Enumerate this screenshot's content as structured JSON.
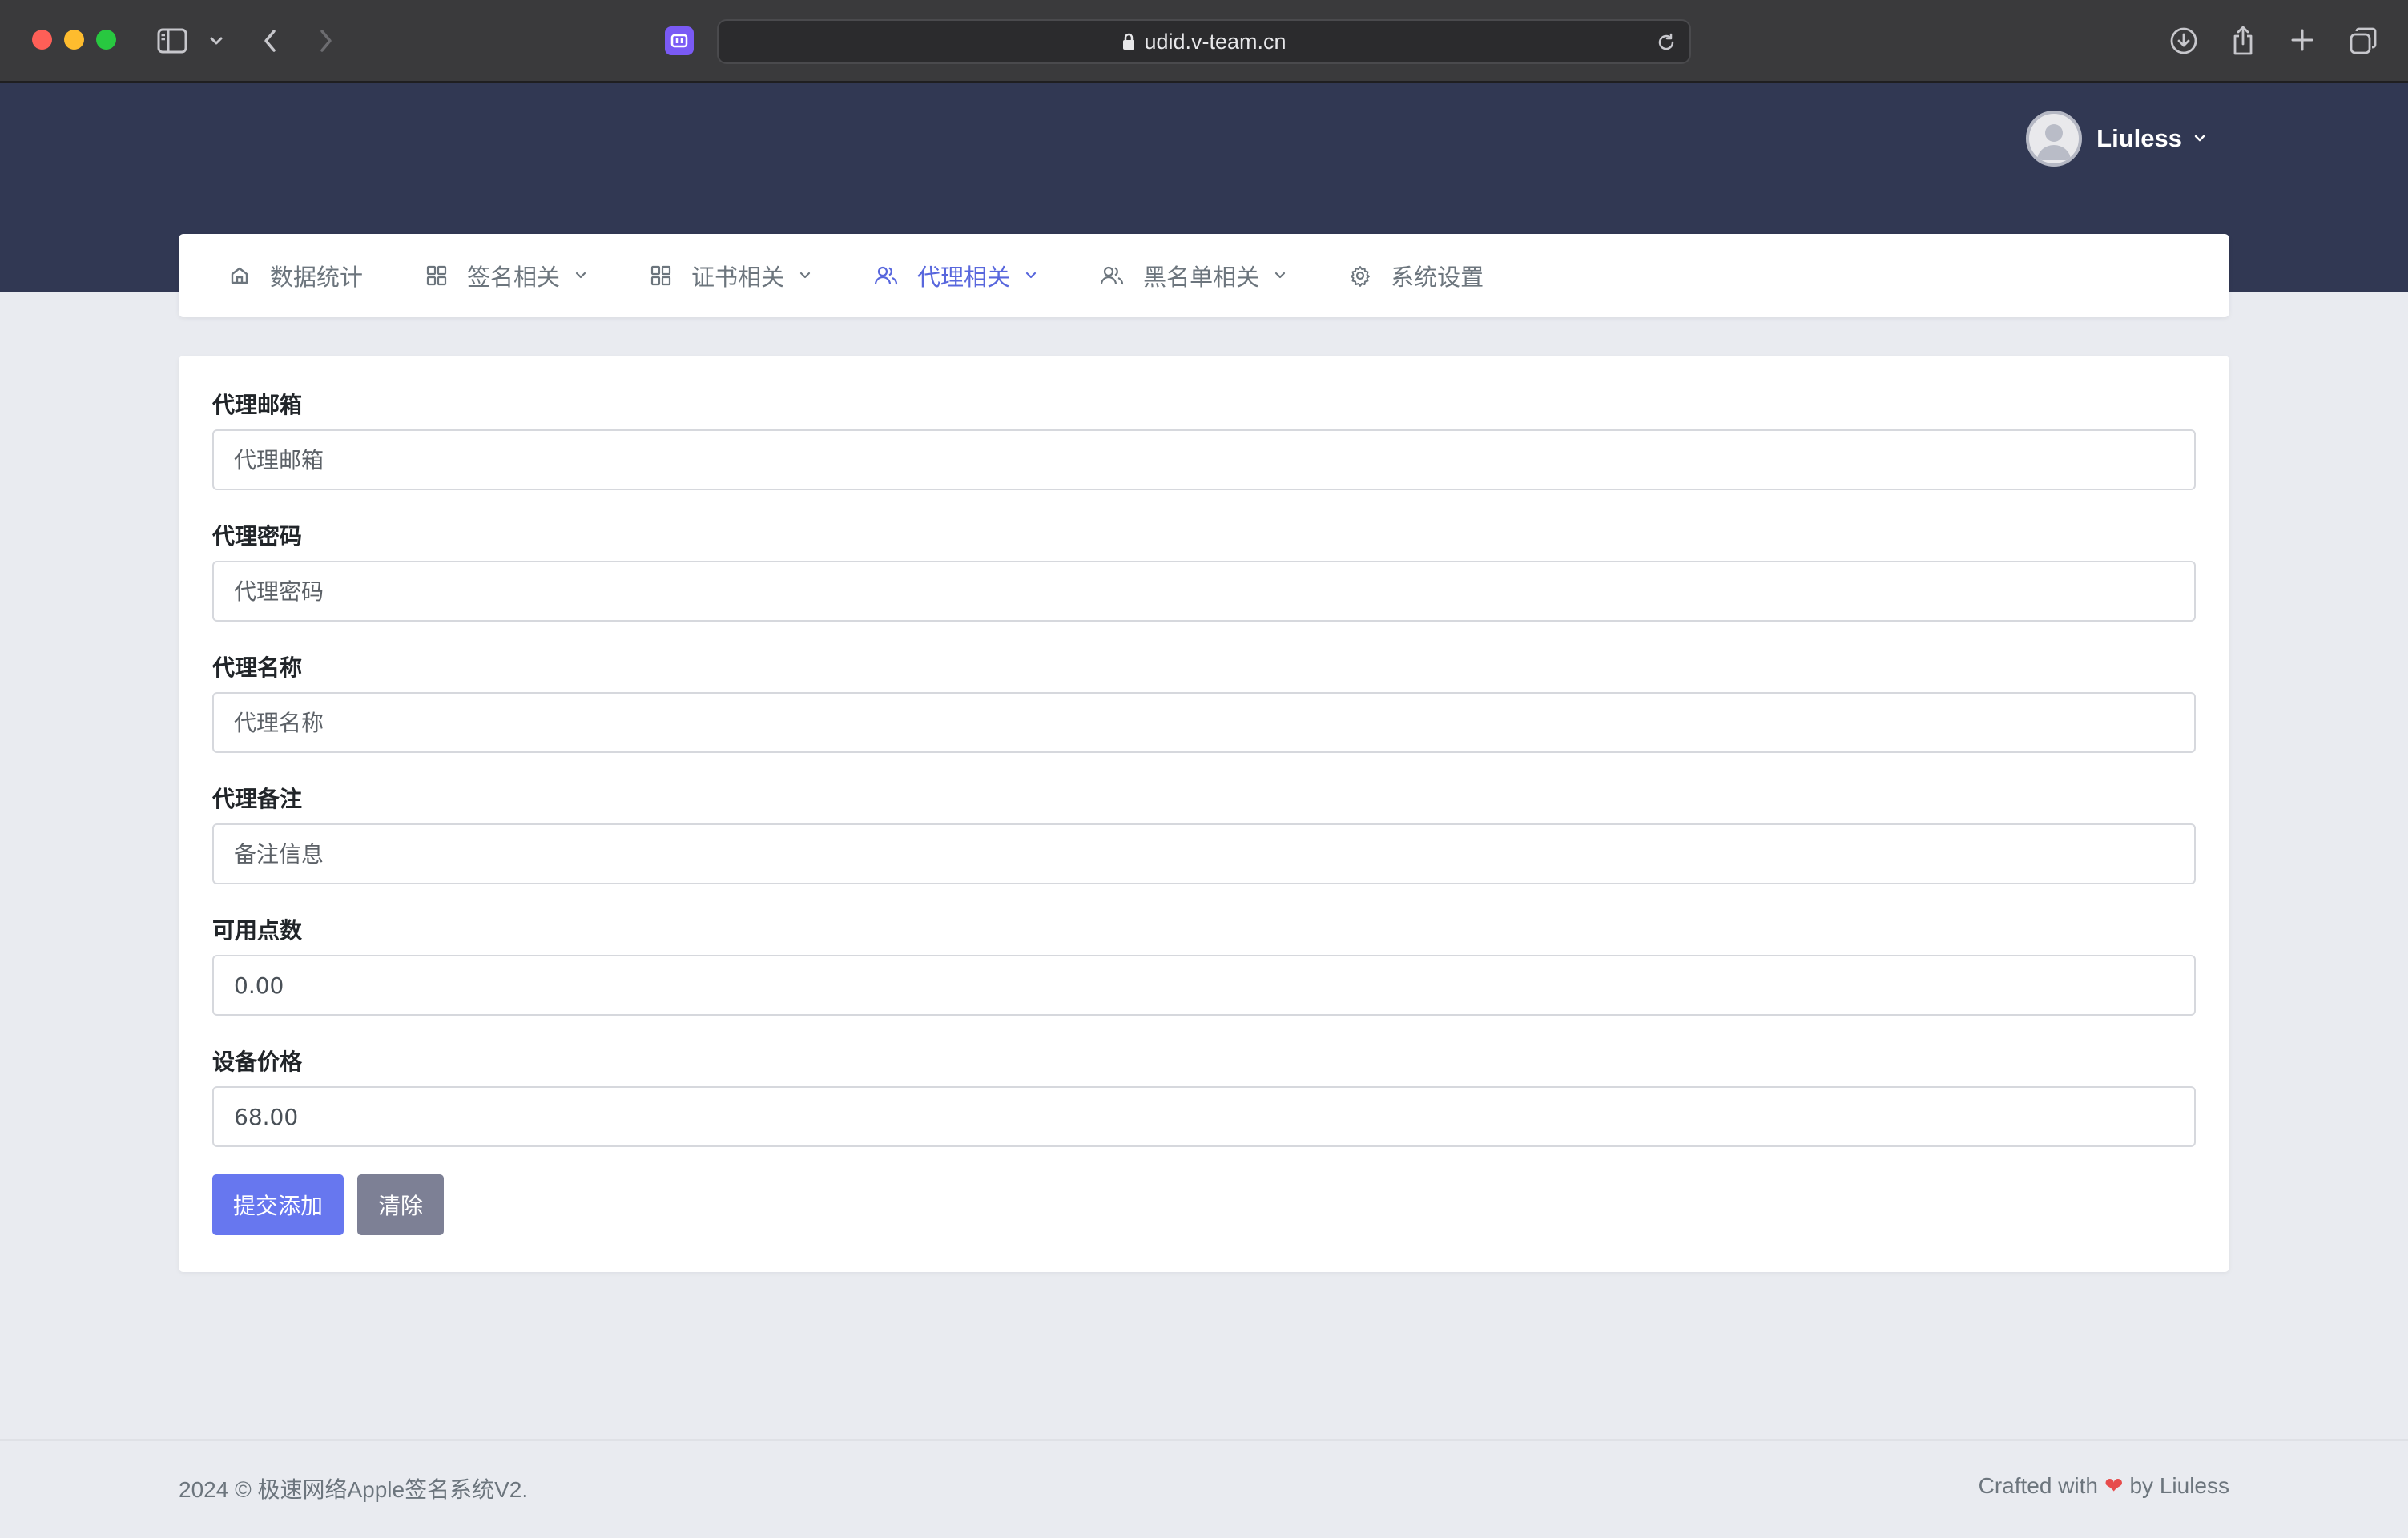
{
  "browser": {
    "url": "udid.v-team.cn"
  },
  "header": {
    "username": "Liuless"
  },
  "nav": [
    {
      "label": "数据统计",
      "icon": "home-icon",
      "has_caret": false,
      "active": false
    },
    {
      "label": "签名相关",
      "icon": "grid-icon",
      "has_caret": true,
      "active": false
    },
    {
      "label": "证书相关",
      "icon": "grid-icon",
      "has_caret": true,
      "active": false
    },
    {
      "label": "代理相关",
      "icon": "users-icon",
      "has_caret": true,
      "active": true
    },
    {
      "label": "黑名单相关",
      "icon": "users-icon",
      "has_caret": true,
      "active": false
    },
    {
      "label": "系统设置",
      "icon": "gear-icon",
      "has_caret": false,
      "active": false
    }
  ],
  "form": {
    "fields": [
      {
        "label": "代理邮箱",
        "placeholder": "代理邮箱",
        "value": ""
      },
      {
        "label": "代理密码",
        "placeholder": "代理密码",
        "value": ""
      },
      {
        "label": "代理名称",
        "placeholder": "代理名称",
        "value": ""
      },
      {
        "label": "代理备注",
        "placeholder": "备注信息",
        "value": ""
      },
      {
        "label": "可用点数",
        "placeholder": "",
        "value": "0.00"
      },
      {
        "label": "设备价格",
        "placeholder": "",
        "value": "68.00"
      }
    ],
    "submit_label": "提交添加",
    "clear_label": "清除"
  },
  "footer": {
    "copyright": "2024 © 极速网络Apple签名系统V2.",
    "crafted_prefix": "Crafted with",
    "crafted_suffix": "by Liuless"
  },
  "colors": {
    "header_bg": "#313853",
    "accent": "#5867dd",
    "primary_button": "#6777ef",
    "secondary_button": "#7d8095",
    "heart": "#e74c4c"
  }
}
